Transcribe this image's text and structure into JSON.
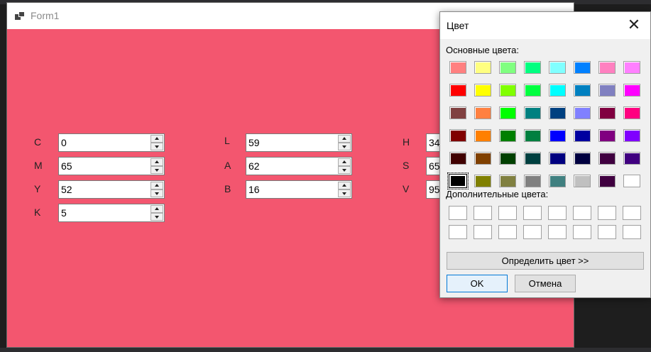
{
  "form": {
    "title": "Form1",
    "background": "#f3566f",
    "cmyk": [
      {
        "label": "C",
        "value": "0"
      },
      {
        "label": "M",
        "value": "65"
      },
      {
        "label": "Y",
        "value": "52"
      },
      {
        "label": "K",
        "value": "5"
      }
    ],
    "lab": [
      {
        "label": "L",
        "value": "59"
      },
      {
        "label": "A",
        "value": "62"
      },
      {
        "label": "B",
        "value": "16"
      }
    ],
    "hsv": [
      {
        "label": "H",
        "value": "34"
      },
      {
        "label": "S",
        "value": "65"
      },
      {
        "label": "V",
        "value": "95"
      }
    ]
  },
  "dialog": {
    "title": "Цвет",
    "close_glyph": "✕",
    "basic_colors_label": "Основные цвета:",
    "custom_colors_label": "Дополнительные цвета:",
    "define_button": "Определить цвет >>",
    "ok_button": "OK",
    "cancel_button": "Отмена",
    "selected_color": "#000000",
    "basic_colors": [
      [
        "#ff8080",
        "#ffff80",
        "#80ff80",
        "#00ff80",
        "#80ffff",
        "#0080ff",
        "#ff80c0",
        "#ff80ff"
      ],
      [
        "#ff0000",
        "#ffff00",
        "#80ff00",
        "#00ff40",
        "#00ffff",
        "#0080c0",
        "#8080c0",
        "#ff00ff"
      ],
      [
        "#804040",
        "#ff8040",
        "#00ff00",
        "#008080",
        "#004080",
        "#8080ff",
        "#800040",
        "#ff0080"
      ],
      [
        "#800000",
        "#ff8000",
        "#008000",
        "#008040",
        "#0000ff",
        "#0000a0",
        "#800080",
        "#8000ff"
      ],
      [
        "#400000",
        "#804000",
        "#004000",
        "#004040",
        "#000080",
        "#000040",
        "#400040",
        "#400080"
      ],
      [
        "#000000",
        "#808000",
        "#808040",
        "#808080",
        "#408080",
        "#c0c0c0",
        "#400040",
        "#ffffff"
      ]
    ],
    "custom_colors": [
      [
        "#ffffff",
        "#ffffff",
        "#ffffff",
        "#ffffff",
        "#ffffff",
        "#ffffff",
        "#ffffff",
        "#ffffff"
      ],
      [
        "#ffffff",
        "#ffffff",
        "#ffffff",
        "#ffffff",
        "#ffffff",
        "#ffffff",
        "#ffffff",
        "#ffffff"
      ]
    ]
  }
}
